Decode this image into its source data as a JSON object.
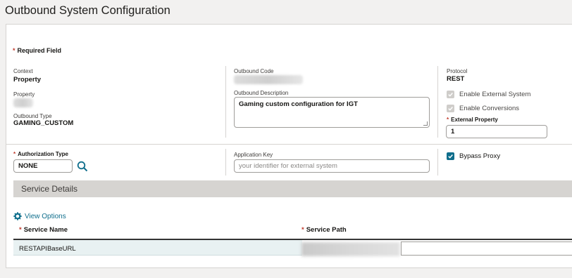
{
  "page": {
    "title": "Outbound System Configuration"
  },
  "form": {
    "required_field_marker": "*",
    "required_field_label": "Required Field",
    "context": {
      "label": "Context",
      "value": "Property"
    },
    "property": {
      "label": "Property"
    },
    "outbound_type": {
      "label": "Outbound Type",
      "value": "GAMING_CUSTOM"
    },
    "outbound_code": {
      "label": "Outbound Code"
    },
    "outbound_description": {
      "label": "Outbound Description",
      "value": "Gaming custom configuration for IGT"
    },
    "protocol": {
      "label": "Protocol",
      "value": "REST"
    },
    "enable_external_system": {
      "label": "Enable External System",
      "checked": true,
      "disabled": true
    },
    "enable_conversions": {
      "label": "Enable Conversions",
      "checked": true,
      "disabled": true
    },
    "external_property": {
      "label": "External Property",
      "value": "1",
      "required": true
    },
    "authorization_type": {
      "label": "Authorization Type",
      "value": "NONE",
      "required": true
    },
    "application_key": {
      "label": "Application Key",
      "placeholder": "your identifier for external system"
    },
    "bypass_proxy": {
      "label": "Bypass Proxy",
      "checked": true
    }
  },
  "service_details": {
    "title": "Service Details",
    "view_options_label": "View Options",
    "columns": [
      {
        "label": "Service Name",
        "required": true
      },
      {
        "label": "Service Path",
        "required": true
      }
    ],
    "rows": [
      {
        "service_name": "RESTAPIBaseURL"
      }
    ]
  },
  "icons": {
    "search": "search-icon",
    "view_options": "gear-icon",
    "checkmark": "check-icon"
  },
  "colors": {
    "accent": "#0f6e8c",
    "required": "#c0392b",
    "section_bar": "#d6d4d1",
    "selected_row": "#e8f1f2"
  }
}
